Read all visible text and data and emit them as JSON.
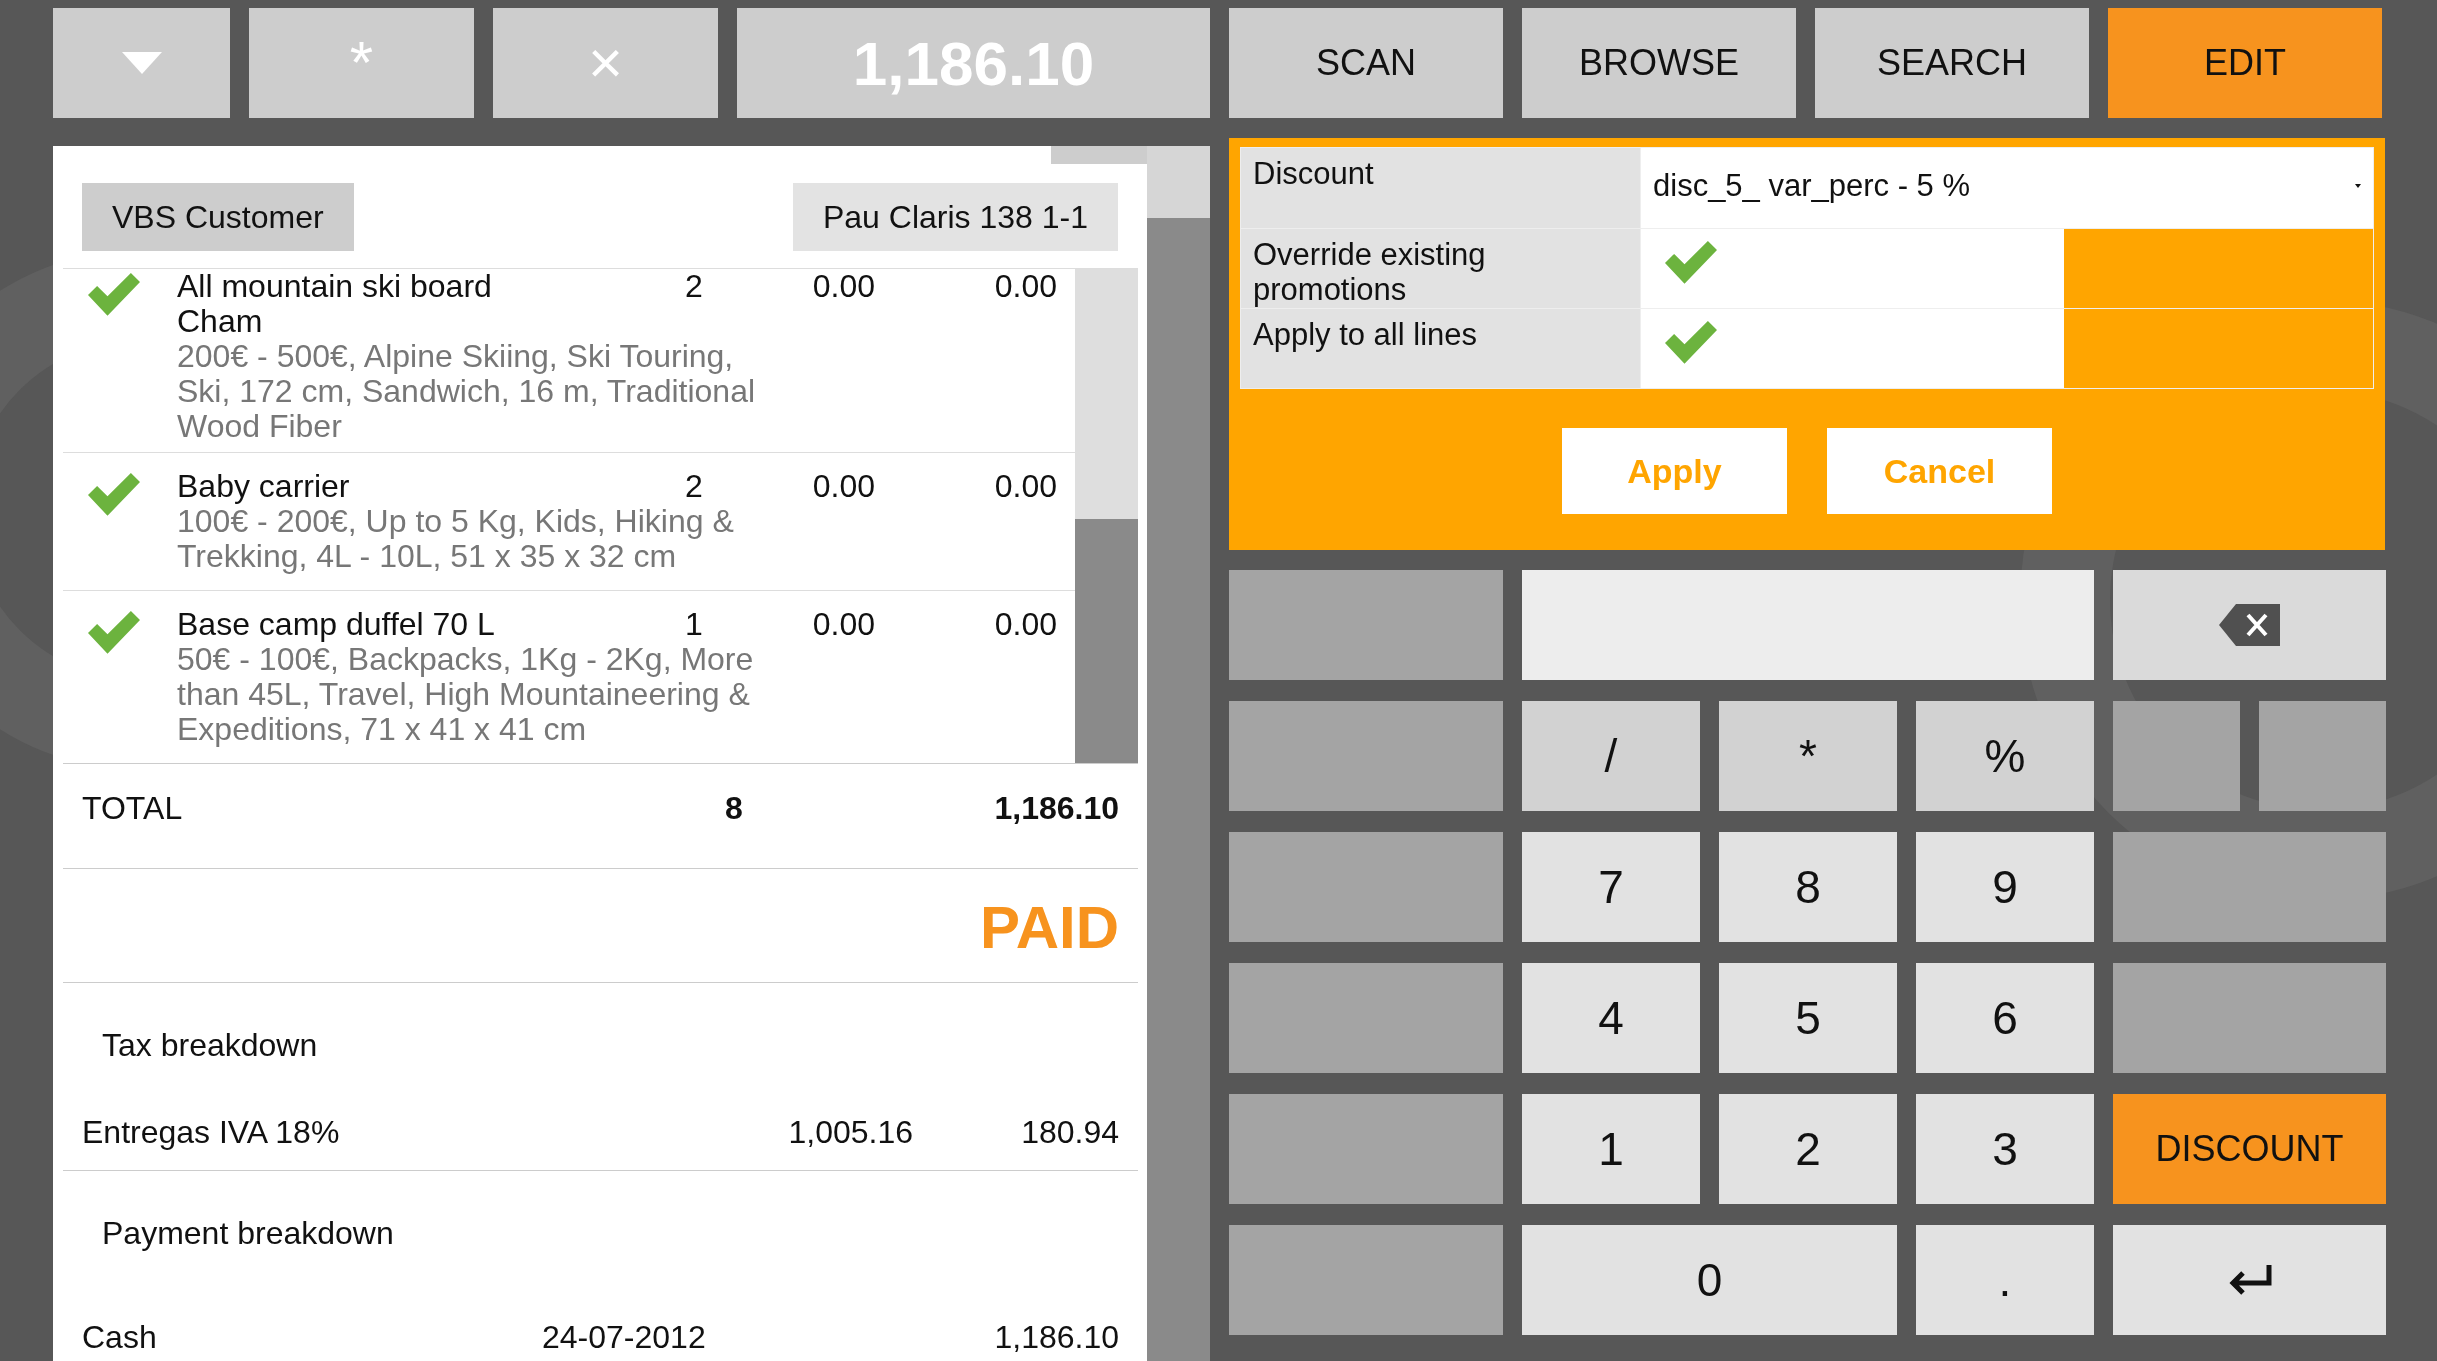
{
  "toolbar": {
    "buttons": [
      {
        "kind": "menu"
      },
      {
        "kind": "text",
        "label": "*"
      },
      {
        "kind": "text",
        "label": "×"
      }
    ],
    "amount": "1,186.10"
  },
  "tabs": [
    {
      "label": "SCAN",
      "selected": false
    },
    {
      "label": "BROWSE",
      "selected": false
    },
    {
      "label": "SEARCH",
      "selected": false
    },
    {
      "label": "EDIT",
      "selected": true
    }
  ],
  "receipt": {
    "customer": "VBS Customer",
    "location": "Pau Claris 138 1-1",
    "lines": [
      {
        "name": "All mountain ski board Cham",
        "qty": "2",
        "price": "0.00",
        "total": "0.00",
        "description": "200€ - 500€, Alpine Skiing, Ski Touring, Ski, 172 cm, Sandwich, 16 m, Traditional Wood Fiber",
        "checked": true
      },
      {
        "name": "Baby carrier",
        "qty": "2",
        "price": "0.00",
        "total": "0.00",
        "description": "100€ - 200€, Up to 5 Kg, Kids, Hiking & Trekking, 4L - 10L, 51 x 35 x 32 cm",
        "checked": true
      },
      {
        "name": "Base camp duffel 70 L",
        "qty": "1",
        "price": "0.00",
        "total": "0.00",
        "description": "50€ - 100€, Backpacks, 1Kg - 2Kg, More than 45L, Travel, High Mountaineering & Expeditions, 71 x 41 x 41 cm",
        "checked": true
      }
    ],
    "total": {
      "label": "TOTAL",
      "qty": "8",
      "amount": "1,186.10"
    },
    "status": "PAID",
    "tax": {
      "title": "Tax breakdown",
      "rows": [
        {
          "name": "Entregas IVA 18%",
          "base": "1,005.16",
          "amount": "180.94"
        }
      ]
    },
    "payment": {
      "title": "Payment breakdown",
      "rows": [
        {
          "method": "Cash",
          "date": "24-07-2012",
          "amount": "1,186.10"
        }
      ]
    }
  },
  "discount_form": {
    "fields": [
      {
        "kind": "select",
        "label": "Discount",
        "value": "disc_5_ var_perc - 5 %"
      },
      {
        "kind": "check",
        "label": "Override existing promotions",
        "checked": true
      },
      {
        "kind": "check",
        "label": "Apply to all lines",
        "checked": true
      }
    ],
    "buttons": [
      "Apply",
      "Cancel"
    ]
  },
  "keypad": {
    "keys": [
      {
        "kind": "blank"
      },
      {
        "kind": "field"
      },
      {
        "kind": "backspace"
      },
      {
        "kind": "blank"
      },
      {
        "kind": "op",
        "label": "/"
      },
      {
        "kind": "op",
        "label": "*"
      },
      {
        "kind": "op",
        "label": "%"
      },
      {
        "kind": "small_blank"
      },
      {
        "kind": "small_blank"
      },
      {
        "kind": "blank"
      },
      {
        "kind": "key",
        "label": "7"
      },
      {
        "kind": "key",
        "label": "8"
      },
      {
        "kind": "key",
        "label": "9"
      },
      {
        "kind": "wide_blank"
      },
      {
        "kind": "blank"
      },
      {
        "kind": "key",
        "label": "4"
      },
      {
        "kind": "key",
        "label": "5"
      },
      {
        "kind": "key",
        "label": "6"
      },
      {
        "kind": "wide_blank"
      },
      {
        "kind": "blank"
      },
      {
        "kind": "key",
        "label": "1"
      },
      {
        "kind": "key",
        "label": "2"
      },
      {
        "kind": "key",
        "label": "3"
      },
      {
        "kind": "highlight",
        "label": "DISCOUNT"
      },
      {
        "kind": "blank"
      },
      {
        "kind": "wide_key",
        "label": "0"
      },
      {
        "kind": "key",
        "label": "."
      },
      {
        "kind": "enter"
      }
    ]
  }
}
